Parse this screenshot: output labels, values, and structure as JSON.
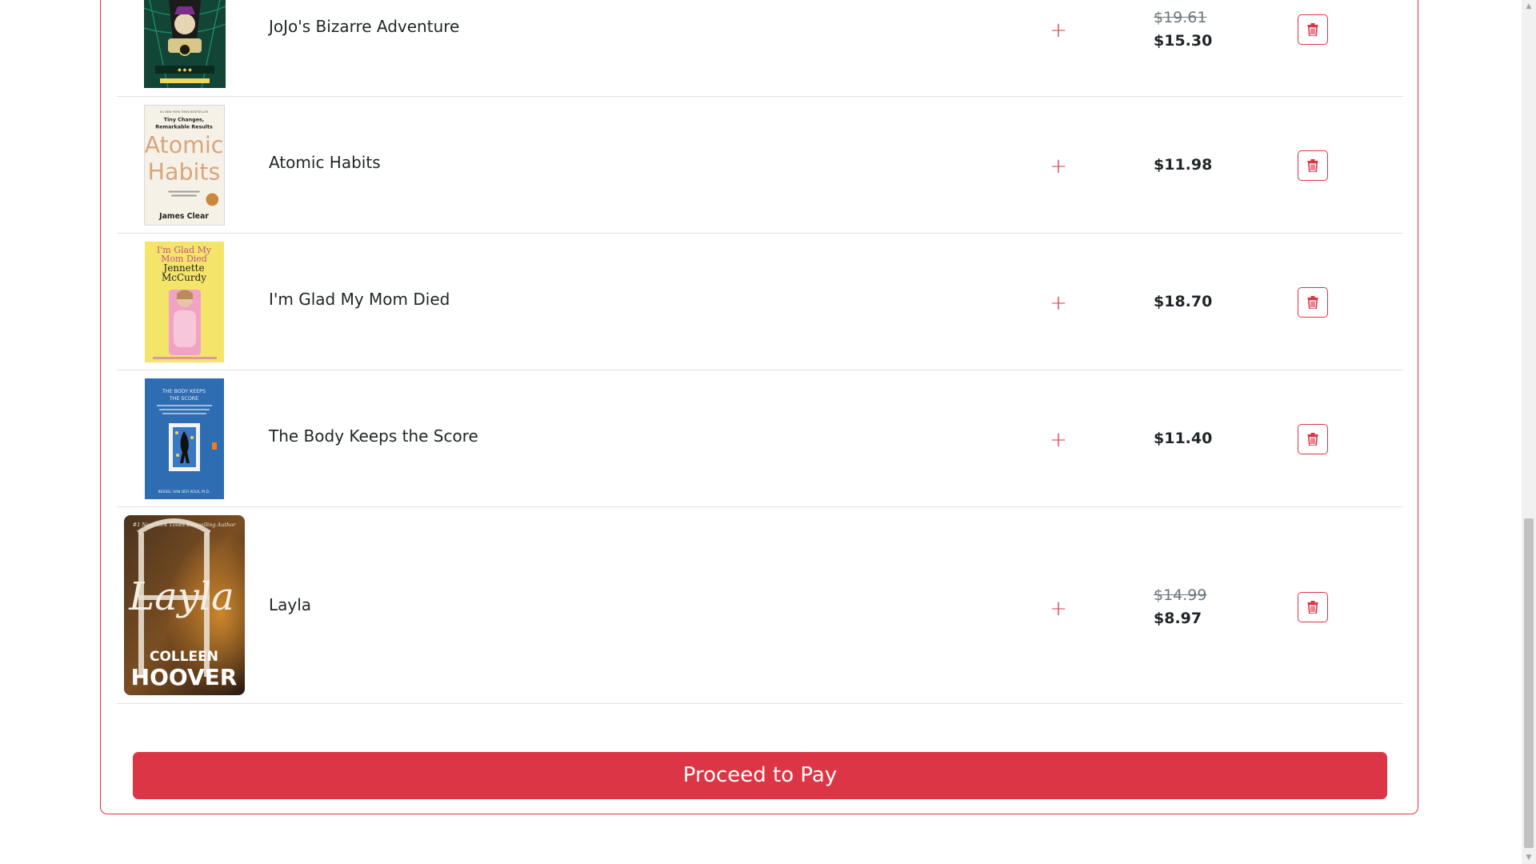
{
  "cart": {
    "items": [
      {
        "title": "JoJo's Bizarre Adventure",
        "original_price": "$19.61",
        "price": "$15.30",
        "add_label": "+",
        "cover_icon": "book-cover-jojo"
      },
      {
        "title": "Atomic Habits",
        "original_price": "",
        "price": "$11.98",
        "add_label": "+",
        "cover_icon": "book-cover-atomic-habits",
        "cover_text": {
          "top": "#1 NEW YORK TIMES BESTSELLER",
          "tag1": "Tiny Changes,",
          "tag2": "Remarkable Results",
          "word1": "Atomic",
          "word2": "Habits",
          "author": "James Clear"
        }
      },
      {
        "title": "I'm Glad My Mom Died",
        "original_price": "",
        "price": "$18.70",
        "add_label": "+",
        "cover_icon": "book-cover-glad-mom-died",
        "cover_text": {
          "line1": "I'm Glad My",
          "line2": "Mom Died",
          "author1": "Jennette",
          "author2": "McCurdy"
        }
      },
      {
        "title": "The Body Keeps the Score",
        "original_price": "",
        "price": "$11.40",
        "add_label": "+",
        "cover_icon": "book-cover-body-keeps-score",
        "cover_text": {
          "line1": "THE BODY KEEPS",
          "line2": "THE SCORE",
          "author": "BESSEL VAN DER KOLK, M.D."
        }
      },
      {
        "title": "Layla",
        "original_price": "$14.99",
        "price": "$8.97",
        "add_label": "+",
        "cover_icon": "book-cover-layla",
        "cover_text": {
          "top": "#1 New York Times Bestselling Author",
          "script": "Layla",
          "author1": "COLLEEN",
          "author2": "HOOVER"
        }
      }
    ]
  },
  "checkout": {
    "pay_label": "Proceed to Pay"
  },
  "colors": {
    "accent": "#dc3545",
    "divider": "#dee2e6",
    "muted": "#6c757d"
  }
}
